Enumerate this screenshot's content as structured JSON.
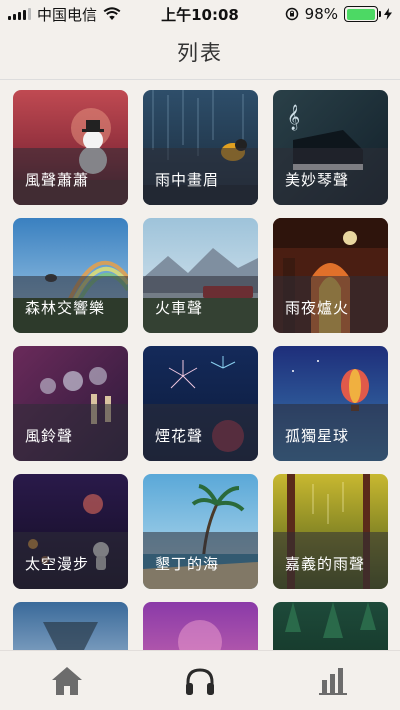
{
  "status_bar": {
    "carrier": "中国电信",
    "time": "上午10:08",
    "battery": "98%",
    "battery_level": 0.98
  },
  "header": {
    "title": "列表"
  },
  "sounds": [
    {
      "label": "風聲蕭蕭",
      "icon": "snowman-scene"
    },
    {
      "label": "雨中畫眉",
      "icon": "bird-in-rain-scene"
    },
    {
      "label": "美妙琴聲",
      "icon": "piano-scene"
    },
    {
      "label": "森林交響樂",
      "icon": "rainbow-bird-scene"
    },
    {
      "label": "火車聲",
      "icon": "train-scene"
    },
    {
      "label": "雨夜爐火",
      "icon": "fireplace-scene"
    },
    {
      "label": "風鈴聲",
      "icon": "wind-chime-scene"
    },
    {
      "label": "煙花聲",
      "icon": "fireworks-scene"
    },
    {
      "label": "孤獨星球",
      "icon": "hot-air-balloon-scene"
    },
    {
      "label": "太空漫步",
      "icon": "astronaut-scene"
    },
    {
      "label": "墾丁的海",
      "icon": "beach-scene"
    },
    {
      "label": "嘉義的雨聲",
      "icon": "forest-rain-scene"
    },
    {
      "label": "",
      "icon": "tornado-scene"
    },
    {
      "label": "",
      "icon": "purple-dusk-scene"
    },
    {
      "label": "",
      "icon": "green-forest-scene"
    }
  ],
  "tabs": [
    {
      "name": "home",
      "icon": "home-icon",
      "active": true
    },
    {
      "name": "listen",
      "icon": "headphones-icon",
      "active": false
    },
    {
      "name": "stats",
      "icon": "bar-chart-icon",
      "active": false
    }
  ],
  "colors": {
    "background": "#f3f0ec",
    "battery": "#4cd964",
    "tab_icon": "#6c6c6c"
  }
}
